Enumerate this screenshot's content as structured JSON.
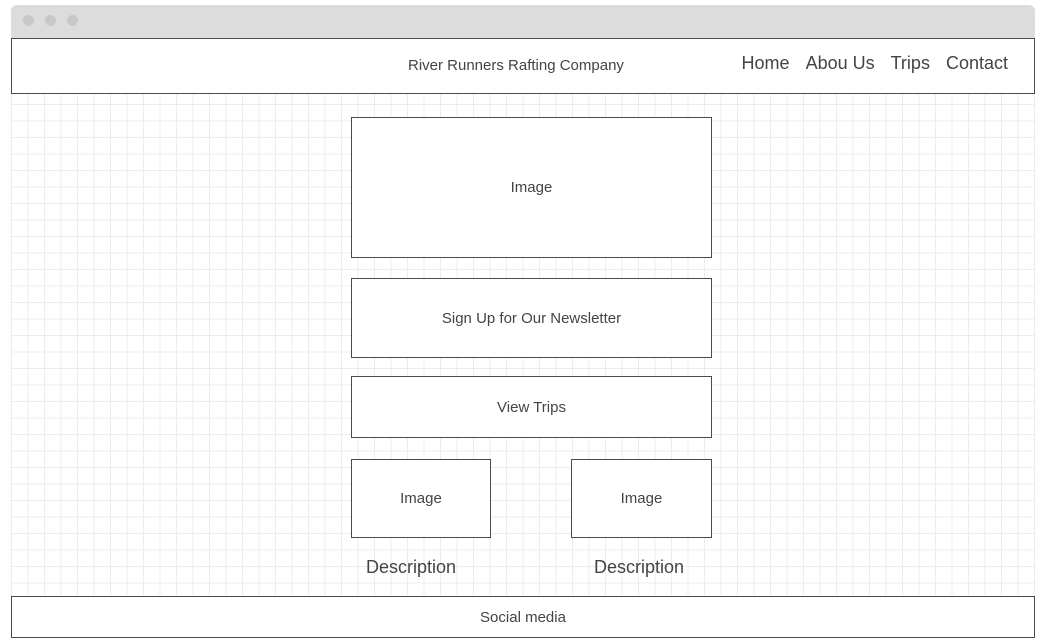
{
  "header": {
    "brand": "River Runners Rafting Company",
    "nav": [
      "Home",
      "Abou Us",
      "Trips",
      "Contact"
    ]
  },
  "main": {
    "hero_image_label": "Image",
    "newsletter_label": "Sign Up for Our Newsletter",
    "view_trips_label": "View Trips",
    "cards": [
      {
        "image_label": "Image",
        "description": "Description"
      },
      {
        "image_label": "Image",
        "description": "Description"
      }
    ]
  },
  "footer": {
    "label": "Social media"
  }
}
